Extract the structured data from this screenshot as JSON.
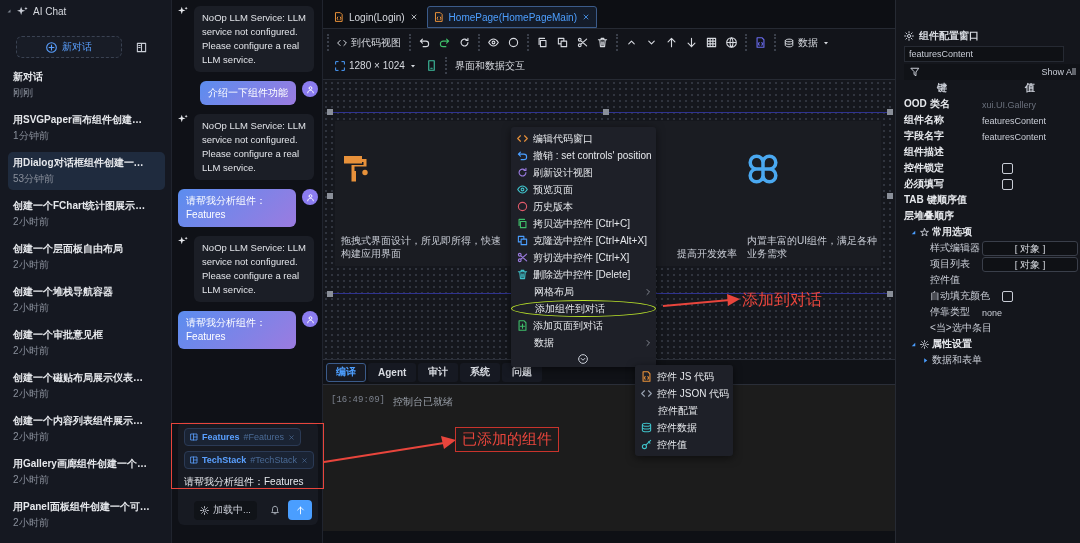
{
  "sidebar": {
    "title": "AI Chat",
    "new_chat_button": "新对话",
    "conversations": [
      {
        "title": "新对话",
        "time": "刚刚",
        "selected": false
      },
      {
        "title": "用SVGPaper画布组件创建…",
        "time": "1分钟前",
        "selected": false
      },
      {
        "title": "用Dialog对话框组件创建一…",
        "time": "53分钟前",
        "selected": true
      },
      {
        "title": "创建一个FChart统计图展示…",
        "time": "2小时前",
        "selected": false
      },
      {
        "title": "创建一个层面板自由布局",
        "time": "2小时前",
        "selected": false
      },
      {
        "title": "创建一个堆栈导航容器",
        "time": "2小时前",
        "selected": false
      },
      {
        "title": "创建一个审批意见框",
        "time": "2小时前",
        "selected": false
      },
      {
        "title": "创建一个磁贴布局展示仪表…",
        "time": "2小时前",
        "selected": false
      },
      {
        "title": "创建一个内容列表组件展示…",
        "time": "2小时前",
        "selected": false
      },
      {
        "title": "用Gallery画廊组件创建一个…",
        "time": "2小时前",
        "selected": false
      },
      {
        "title": "用Panel面板组件创建一个可…",
        "time": "2小时前",
        "selected": false
      }
    ]
  },
  "chat": {
    "messages": [
      {
        "kind": "assistant",
        "text": "NoOp LLM Service: LLM service not configured. Please configure a real LLM service."
      },
      {
        "kind": "user",
        "text": "介绍一下组件功能"
      },
      {
        "kind": "assistant",
        "text": "NoOp LLM Service: LLM service not configured. Please configure a real LLM service."
      },
      {
        "kind": "user",
        "text": "请帮我分析组件：Features"
      },
      {
        "kind": "assistant",
        "text": "NoOp LLM Service: LLM service not configured. Please configure a real LLM service."
      },
      {
        "kind": "user",
        "text": "请帮我分析组件：Features"
      }
    ],
    "composer": {
      "chips": [
        {
          "name": "Features",
          "tag": "#Features"
        },
        {
          "name": "TechStack",
          "tag": "#TechStack"
        }
      ],
      "value": "请帮我分析组件：Features",
      "mode_button": "加载中..."
    }
  },
  "editor": {
    "tabs": [
      {
        "label": "Login(Login)",
        "selected": false
      },
      {
        "label": "HomePage(HomePageMain)",
        "selected": true
      }
    ],
    "toolbar": {
      "code_view_button": "到代码视图",
      "data_menu": "数据",
      "resolution": "1280 × 1024",
      "mode_label": "界面和数据交互"
    },
    "canvas": {
      "captions": [
        "拖拽式界面设计，所见即所得，快速构建应用界面",
        "提高开发效率",
        "内置丰富的UI组件，满足各种业务需求"
      ]
    },
    "context_menu": {
      "items": [
        {
          "label": "编辑代码窗口",
          "kind": "item",
          "highlighted": false
        },
        {
          "label": "撤销 : set controls' position",
          "kind": "item",
          "highlighted": false
        },
        {
          "label": "刷新设计视图",
          "kind": "item",
          "highlighted": false
        },
        {
          "label": "预览页面",
          "kind": "item",
          "highlighted": false
        },
        {
          "label": "历史版本",
          "kind": "item",
          "highlighted": false
        },
        {
          "label": "拷贝选中控件 [Ctrl+C]",
          "kind": "item",
          "highlighted": false
        },
        {
          "label": "克隆选中控件 [Ctrl+Alt+X]",
          "kind": "item",
          "highlighted": false
        },
        {
          "label": "剪切选中控件 [Ctrl+X]",
          "kind": "item",
          "highlighted": false
        },
        {
          "label": "删除选中控件 [Delete]",
          "kind": "item",
          "highlighted": false
        },
        {
          "label": "网格布局",
          "kind": "submenu",
          "highlighted": false
        },
        {
          "label": "添加组件到对话",
          "kind": "item",
          "highlighted": true
        },
        {
          "label": "添加页面到对话",
          "kind": "item",
          "highlighted": false
        },
        {
          "label": "数据",
          "kind": "submenu",
          "highlighted": false
        }
      ]
    },
    "submenu": {
      "items": [
        "控件 JS 代码",
        "控件 JSON 代码",
        "控件配置",
        "控件数据",
        "控件值"
      ]
    },
    "console": {
      "tabs": [
        {
          "label": "编译",
          "selected": true
        },
        {
          "label": "Agent",
          "selected": false
        },
        {
          "label": "审计",
          "selected": false
        },
        {
          "label": "系统",
          "selected": false
        },
        {
          "label": "问题",
          "selected": false
        }
      ],
      "lines": [
        {
          "time": "[16:49:09]",
          "text": "控制台已就绪"
        }
      ]
    }
  },
  "properties": {
    "title": "组件配置窗口",
    "search_value": "featuresContent",
    "filter_label": "Show All",
    "columns": [
      "键",
      "值"
    ],
    "rows": [
      {
        "key": "OOD 类名",
        "placeholder": "xui.UI.Gallery",
        "kind": "field"
      },
      {
        "key": "组件名称",
        "value": "featuresContent",
        "kind": "text"
      },
      {
        "key": "字段名字",
        "value": "featuresContent",
        "kind": "text"
      },
      {
        "key": "组件描述",
        "kind": "text"
      },
      {
        "key": "控件锁定",
        "kind": "checkbox",
        "checked": false
      },
      {
        "key": "必须填写",
        "kind": "checkbox",
        "checked": false
      },
      {
        "key": "TAB 键顺序值",
        "kind": "text"
      },
      {
        "key": "层堆叠顺序",
        "kind": "text"
      },
      {
        "key": "常用选项",
        "kind": "group",
        "expanded": true,
        "children": [
          {
            "key": "样式编辑器",
            "value": "[ 对象 ]",
            "kind": "object"
          },
          {
            "key": "项目列表",
            "value": "[ 对象 ]",
            "kind": "object"
          },
          {
            "key": "控件值",
            "kind": "text"
          },
          {
            "key": "自动填充颜色",
            "kind": "checkbox",
            "checked": false
          },
          {
            "key": "停靠类型",
            "value": "none",
            "kind": "text"
          },
          {
            "key": "<当>选中条目",
            "kind": "text"
          }
        ]
      },
      {
        "key": "属性设置",
        "kind": "group",
        "expanded": true,
        "children": [
          {
            "key": "数据和表单",
            "kind": "group",
            "expanded": false
          }
        ]
      }
    ]
  },
  "annotations": [
    {
      "text": "添加到对话"
    },
    {
      "text": "已添加的组件"
    }
  ]
}
